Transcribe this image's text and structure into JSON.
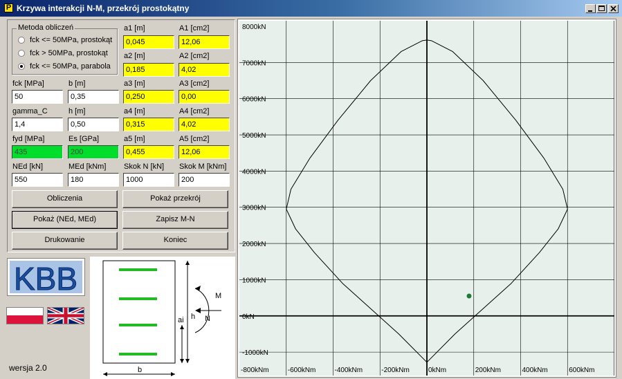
{
  "window": {
    "title": "Krzywa interakcji N-M, przekrój prostokątny",
    "icon_letter": "P"
  },
  "method_group": {
    "title": "Metoda obliczeń",
    "options": [
      {
        "label": "fck <= 50MPa, prostokąt",
        "selected": false
      },
      {
        "label": "fck > 50MPa, prostokąt",
        "selected": false
      },
      {
        "label": "fck <= 50MPa, parabola",
        "selected": true
      }
    ]
  },
  "fields": {
    "a1": {
      "label": "a1 [m]",
      "value": "0,045"
    },
    "A1": {
      "label": "A1 [cm2]",
      "value": "12,06"
    },
    "a2": {
      "label": "a2 [m]",
      "value": "0,185"
    },
    "A2": {
      "label": "A2 [cm2]",
      "value": "4,02"
    },
    "fck": {
      "label": "fck [MPa]",
      "value": "50"
    },
    "b": {
      "label": "b [m]",
      "value": "0,35"
    },
    "a3": {
      "label": "a3 [m]",
      "value": "0,250"
    },
    "A3": {
      "label": "A3 [cm2]",
      "value": "0,00"
    },
    "gamma_c": {
      "label": "gamma_C",
      "value": "1,4"
    },
    "h": {
      "label": "h [m]",
      "value": "0,50"
    },
    "a4": {
      "label": "a4 [m]",
      "value": "0,315"
    },
    "A4": {
      "label": "A4 [cm2]",
      "value": "4,02"
    },
    "fyd": {
      "label": "fyd [MPa]",
      "value": "435"
    },
    "Es": {
      "label": "Es [GPa]",
      "value": "200"
    },
    "a5": {
      "label": "a5 [m]",
      "value": "0,455"
    },
    "A5": {
      "label": "A5 [cm2]",
      "value": "12,06"
    },
    "NEd": {
      "label": "NEd [kN]",
      "value": "550"
    },
    "MEd": {
      "label": "MEd [kNm]",
      "value": "180"
    },
    "skokN": {
      "label": "Skok N [kN]",
      "value": "1000"
    },
    "skokM": {
      "label": "Skok M [kNm]",
      "value": "200"
    }
  },
  "buttons": {
    "obliczenia": "Obliczenia",
    "pokaz_przekroj": "Pokaż przekrój",
    "pokaz_ned_med": "Pokaż (NEd, MEd)",
    "zapisz": "Zapisz M-N",
    "drukowanie": "Drukowanie",
    "koniec": "Koniec"
  },
  "logo": {
    "text": "KBB"
  },
  "version": "wersja 2.0",
  "cross_section": {
    "b_label": "b",
    "h_label": "h",
    "ai_label": "ai",
    "M_label": "M",
    "N_label": "N"
  },
  "colors": {
    "reinforcement": "#22bb22",
    "yellow_field": "#ffff00",
    "green_field": "#00dd2a",
    "point": "#1f7a3a"
  },
  "chart_data": {
    "type": "line",
    "x_tick_labels": [
      "-800kNm",
      "-600kNm",
      "-400kNm",
      "-200kNm",
      "0kNm",
      "200kNm",
      "400kNm",
      "600kNm"
    ],
    "y_tick_labels": [
      "8000kN",
      "7000kN",
      "6000kN",
      "5000kN",
      "4000kN",
      "3000kN",
      "2000kN",
      "1000kN",
      "0kN",
      "-1000kN"
    ],
    "xlim": [
      -800,
      800
    ],
    "ylim": [
      -1800,
      8000
    ],
    "grid": true,
    "series": [
      {
        "values_xy": [
          [
            0,
            -1280
          ],
          [
            -120,
            -500
          ],
          [
            -240,
            200
          ],
          [
            -360,
            900
          ],
          [
            -480,
            1750
          ],
          [
            -560,
            2400
          ],
          [
            -600,
            2950
          ],
          [
            -580,
            3500
          ],
          [
            -500,
            4350
          ],
          [
            -380,
            5400
          ],
          [
            -240,
            6500
          ],
          [
            -110,
            7300
          ],
          [
            -20,
            7600
          ],
          [
            0,
            7620
          ],
          [
            20,
            7600
          ],
          [
            110,
            7300
          ],
          [
            240,
            6500
          ],
          [
            380,
            5400
          ],
          [
            500,
            4350
          ],
          [
            580,
            3500
          ],
          [
            600,
            2950
          ],
          [
            560,
            2400
          ],
          [
            480,
            1750
          ],
          [
            360,
            900
          ],
          [
            240,
            200
          ],
          [
            120,
            -500
          ],
          [
            0,
            -1280
          ]
        ]
      }
    ],
    "points": [
      {
        "M": 180,
        "N": 550
      }
    ]
  }
}
